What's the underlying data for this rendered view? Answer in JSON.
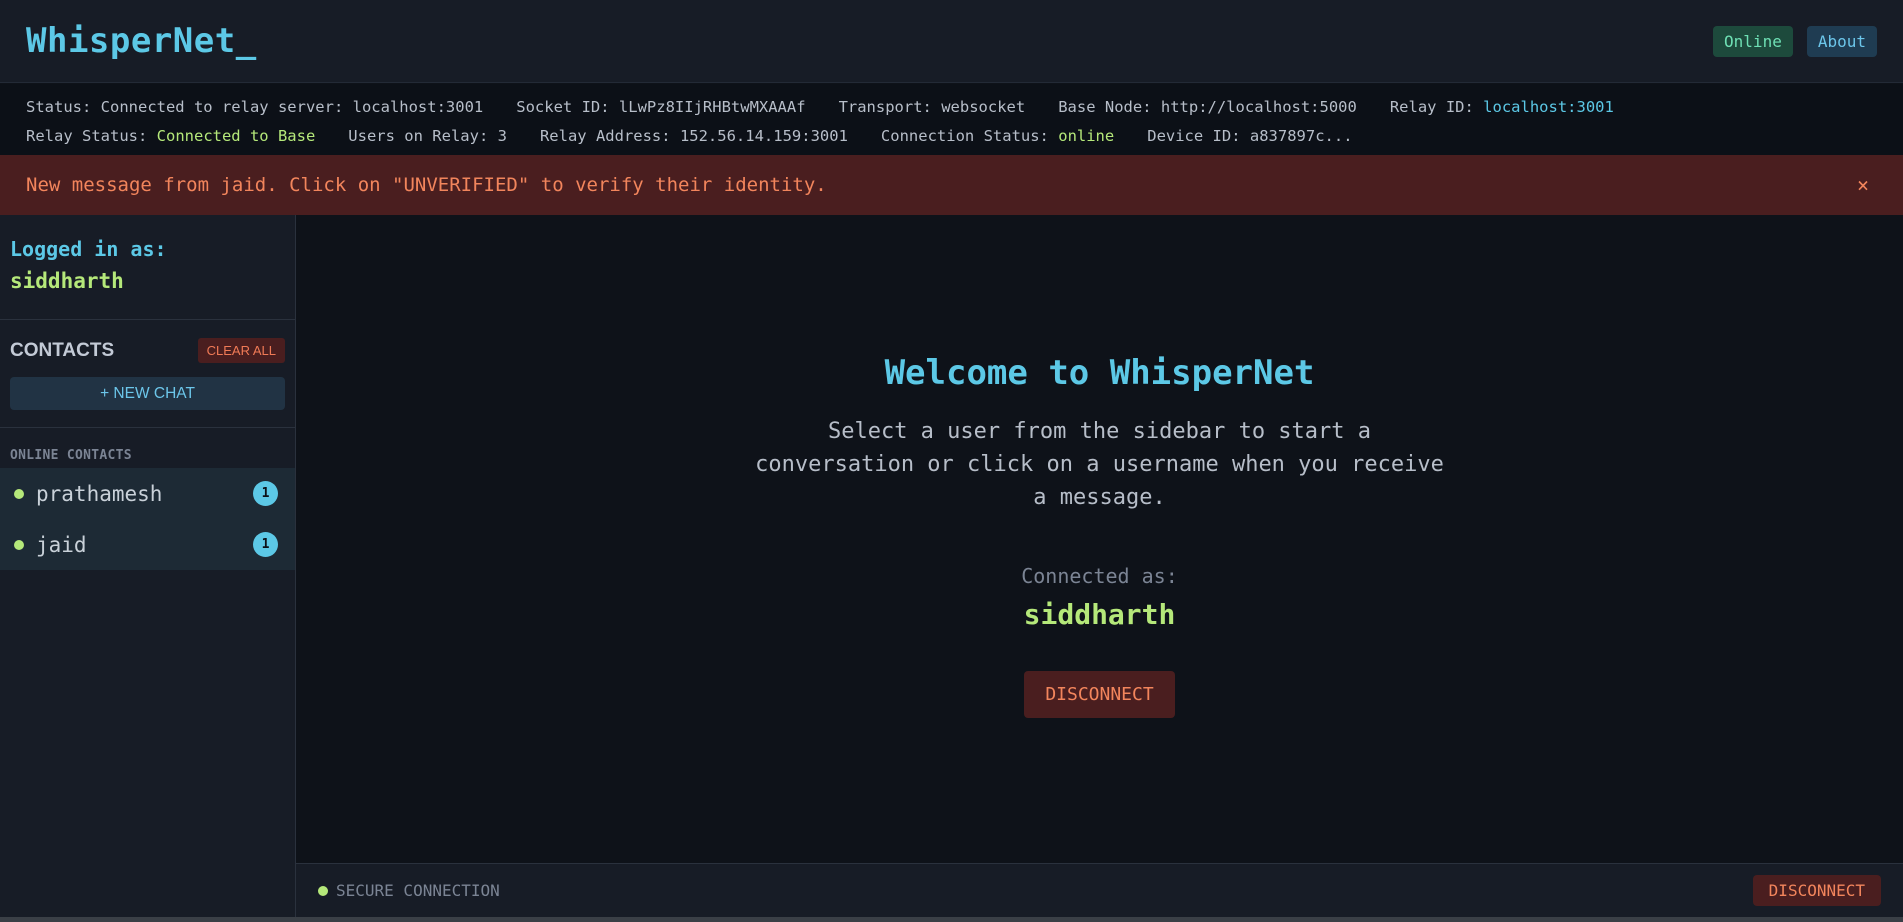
{
  "header": {
    "brand": "WhisperNet_",
    "online_label": "Online",
    "about_label": "About"
  },
  "status": {
    "row1": [
      {
        "label": "Status: ",
        "value": "Connected to relay server: localhost:3001",
        "color": "plain"
      },
      {
        "label": "Socket ID: ",
        "value": "lLwPz8IIjRHBtwMXAAAf",
        "color": "plain"
      },
      {
        "label": "Transport: ",
        "value": "websocket",
        "color": "plain"
      },
      {
        "label": "Base Node: ",
        "value": "http://localhost:5000",
        "color": "plain"
      },
      {
        "label": "Relay ID: ",
        "value": "localhost:3001",
        "color": "blue"
      }
    ],
    "row2": [
      {
        "label": "Relay Status: ",
        "value": "Connected to Base",
        "color": "green"
      },
      {
        "label": "Users on Relay: ",
        "value": "3",
        "color": "plain"
      },
      {
        "label": "Relay Address: ",
        "value": "152.56.14.159:3001",
        "color": "plain"
      },
      {
        "label": "Connection Status: ",
        "value": "online",
        "color": "green"
      },
      {
        "label": "Device ID: ",
        "value": "a837897c...",
        "color": "plain"
      }
    ]
  },
  "alert": {
    "message": "New message from jaid. Click on \"UNVERIFIED\" to verify their identity.",
    "close": "×"
  },
  "sidebar": {
    "logged_in_label": "Logged in as:",
    "username": "siddharth",
    "contacts_title": "CONTACTS",
    "clear_all": "CLEAR ALL",
    "new_chat": "+ NEW CHAT",
    "online_contacts_label": "ONLINE CONTACTS",
    "contacts": [
      {
        "name": "prathamesh",
        "unread": "1"
      },
      {
        "name": "jaid",
        "unread": "1"
      }
    ]
  },
  "main": {
    "title": "Welcome to WhisperNet",
    "text": "Select a user from the sidebar to start a conversation or click on a username when you receive a message.",
    "connected_label": "Connected as:",
    "connected_user": "siddharth",
    "disconnect": "DISCONNECT"
  },
  "footer": {
    "secure": "SECURE CONNECTION",
    "disconnect": "DISCONNECT"
  },
  "colors": {
    "accent_blue": "#5cc8e6",
    "accent_green": "#b5e87a",
    "danger": "#f2855c"
  }
}
